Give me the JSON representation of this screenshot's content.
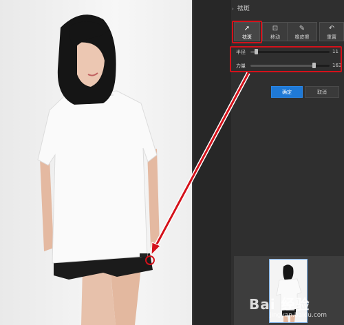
{
  "panel": {
    "section_title": "祛斑",
    "tools": [
      {
        "label": "祛斑",
        "icon": "cursor-plus-icon"
      },
      {
        "label": "移动",
        "icon": "move-icon"
      },
      {
        "label": "橡皮擦",
        "icon": "eraser-icon"
      },
      {
        "label": "重置",
        "icon": "undo-icon"
      }
    ],
    "sliders": [
      {
        "label": "半径",
        "value": "11",
        "level": 0.05
      },
      {
        "label": "力量",
        "value": "163",
        "level": 0.82
      }
    ],
    "confirm_label": "确定",
    "cancel_label": "取消"
  },
  "watermark": {
    "text": "Bai 经验",
    "sub": "jingyan.baidu.com"
  },
  "colors": {
    "annotation": "#d4111a",
    "primary_button": "#1f79d6",
    "panel_bg": "#2f2f2f"
  }
}
